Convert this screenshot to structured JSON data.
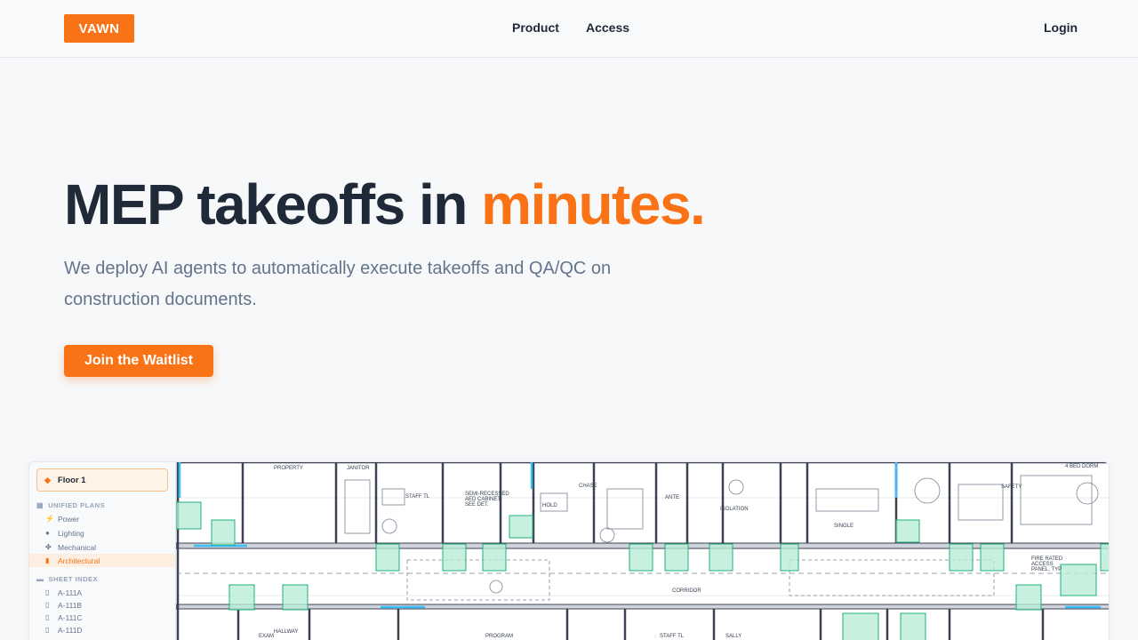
{
  "nav": {
    "logo": "VAWN",
    "links": [
      "Product",
      "Access"
    ],
    "login": "Login"
  },
  "hero": {
    "title_main": "MEP takeoffs in ",
    "title_accent": "minutes.",
    "subtitle": "We deploy AI agents to automatically execute takeoffs and QA/QC on construction documents.",
    "cta": "Join the Waitlist"
  },
  "app": {
    "floor": "Floor 1",
    "unified_plans_label": "UNIFIED PLANS",
    "unified_plans": [
      {
        "label": "Power",
        "icon": "bolt-icon"
      },
      {
        "label": "Lighting",
        "icon": "bulb-icon"
      },
      {
        "label": "Mechanical",
        "icon": "fan-icon"
      },
      {
        "label": "Architectural",
        "icon": "building-icon",
        "active": true
      }
    ],
    "sheet_index_label": "SHEET INDEX",
    "sheets": [
      "A-111A",
      "A-111B",
      "A-111C",
      "A-111D"
    ],
    "plan_labels": {
      "property": "PROPERTY",
      "janitor": "JANITOR",
      "staff_tl": "STAFF TL",
      "semi": "SEMI-RECESSED",
      "aed": "AED CABINET,",
      "seedet": "SEE DET.",
      "chase": "CHASE",
      "ante": "ANTE",
      "isolation": "ISOLATION",
      "hold": "HOLD",
      "single": "SINGLE",
      "safety": "SAFETY",
      "bed4": "4 BED DORM",
      "corridor": "CORRIDOR",
      "hallway": "HALLWAY",
      "program": "PROGRAM",
      "staff_tl2": "STAFF TL",
      "sally": "SALLY",
      "exam": "EXAM",
      "fire": "FIRE RATED",
      "access": "ACCESS",
      "panel": "PANEL, TYP"
    },
    "colors": {
      "accent": "#f97316",
      "highlight": "#22b07d"
    }
  }
}
